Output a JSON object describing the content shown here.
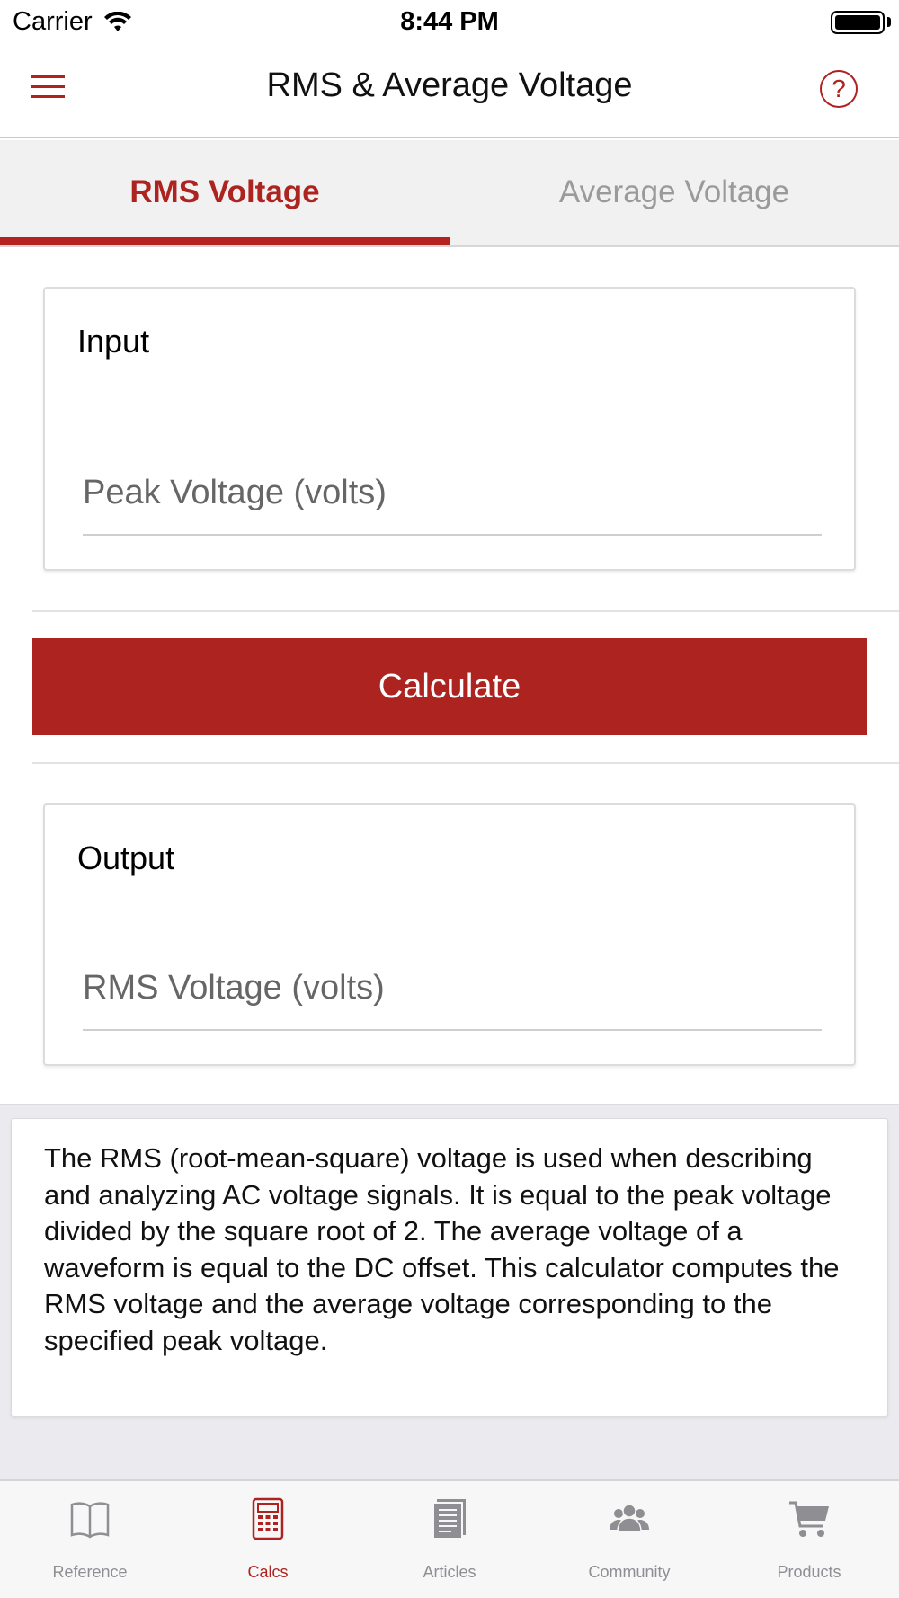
{
  "status_bar": {
    "carrier": "Carrier",
    "time": "8:44 PM"
  },
  "nav": {
    "title": "RMS & Average Voltage",
    "menu_icon": "hamburger-icon",
    "help_icon": "question-circle-icon",
    "help_glyph": "?"
  },
  "tabs": [
    {
      "label": "RMS Voltage",
      "active": true
    },
    {
      "label": "Average Voltage",
      "active": false
    }
  ],
  "input_card": {
    "heading": "Input",
    "field_placeholder": "Peak Voltage (volts)"
  },
  "calculate_label": "Calculate",
  "output_card": {
    "heading": "Output",
    "field_placeholder": "RMS Voltage (volts)"
  },
  "description": "The RMS (root-mean-square) voltage is used when describing and analyzing AC voltage signals. It is equal to the peak voltage divided by the square root of 2. The average voltage of a waveform is equal to the DC offset. This calculator computes the RMS voltage and the average voltage corresponding to the specified peak voltage.",
  "tab_bar": [
    {
      "label": "Reference",
      "icon": "book-icon",
      "active": false
    },
    {
      "label": "Calcs",
      "icon": "calculator-icon",
      "active": true
    },
    {
      "label": "Articles",
      "icon": "document-icon",
      "active": false
    },
    {
      "label": "Community",
      "icon": "people-icon",
      "active": false
    },
    {
      "label": "Products",
      "icon": "cart-icon",
      "active": false
    }
  ],
  "colors": {
    "accent": "#ad2320",
    "inactive": "#8e8e93",
    "tab_background": "#f1f1f2"
  }
}
